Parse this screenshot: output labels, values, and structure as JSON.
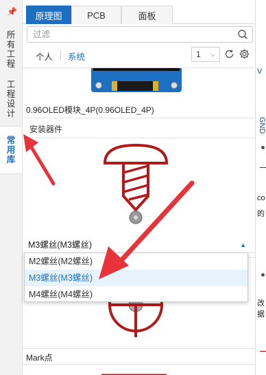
{
  "left_rail": {
    "pin": "📌",
    "tabs": [
      {
        "label_chars": [
          "所",
          "有",
          "工",
          "程"
        ]
      },
      {
        "label_chars": [
          "工",
          "程",
          "设",
          "计"
        ]
      },
      {
        "label_chars": [
          "常",
          "用",
          "库"
        ]
      }
    ]
  },
  "tabs": [
    "原理图",
    "PCB",
    "面板"
  ],
  "search": {
    "placeholder": "过滤"
  },
  "filter": {
    "personal": "个人",
    "system": "系统",
    "page": "1"
  },
  "list": {
    "prev_item_label": "0.96OLED模块_4P(0.96OLED_4P)",
    "section_title": "安装器件",
    "selected_value": "M3螺丝(M3螺丝)",
    "options": [
      "M2螺丝(M2螺丝)",
      "M3螺丝(M3螺丝)",
      "M4螺丝(M4螺丝)"
    ],
    "selected_index": 1,
    "next_item_label": "Mark点"
  },
  "canvas_strip": {
    "texts": [
      "V",
      "GND",
      "co",
      "的",
      "改",
      "据"
    ]
  },
  "colors": {
    "accent": "#1f6fc0",
    "symbol_red": "#b11a1a",
    "annotation_arrow": "#e8333a"
  }
}
